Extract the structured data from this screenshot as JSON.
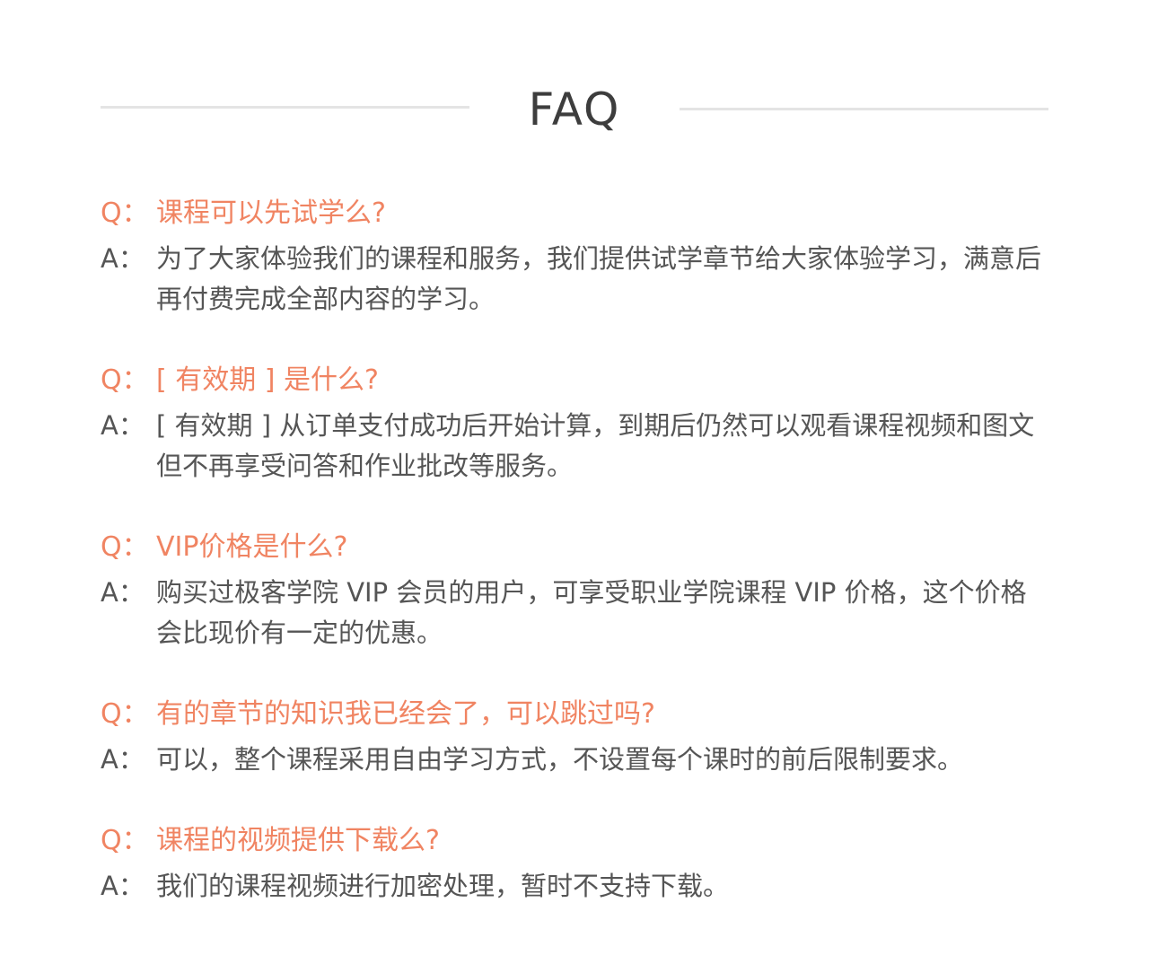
{
  "header": {
    "title": "FAQ"
  },
  "faq": [
    {
      "q_prefix": "Q：",
      "question": "课程可以先试学么?",
      "a_prefix": "A：",
      "answer": "为了大家体验我们的课程和服务，我们提供试学章节给大家体验学习，满意后再付费完成全部内容的学习。"
    },
    {
      "q_prefix": "Q：",
      "question": "[ 有效期 ] 是什么?",
      "a_prefix": "A：",
      "answer": "[ 有效期 ] 从订单支付成功后开始计算，到期后仍然可以观看课程视频和图文但不再享受问答和作业批改等服务。"
    },
    {
      "q_prefix": "Q：",
      "question": "VIP价格是什么?",
      "a_prefix": "A：",
      "answer": "购买过极客学院 VIP 会员的用户，可享受职业学院课程 VIP 价格，这个价格会比现价有一定的优惠。"
    },
    {
      "q_prefix": "Q：",
      "question": "有的章节的知识我已经会了，可以跳过吗?",
      "a_prefix": "A：",
      "answer": "可以，整个课程采用自由学习方式，不设置每个课时的前后限制要求。"
    },
    {
      "q_prefix": "Q：",
      "question": "课程的视频提供下载么?",
      "a_prefix": "A：",
      "answer": "我们的课程视频进行加密处理，暂时不支持下载。"
    }
  ],
  "colors": {
    "question": "#f08462",
    "answer": "#555555",
    "title": "#3d3d3d",
    "rule": "#e4e4e4"
  }
}
